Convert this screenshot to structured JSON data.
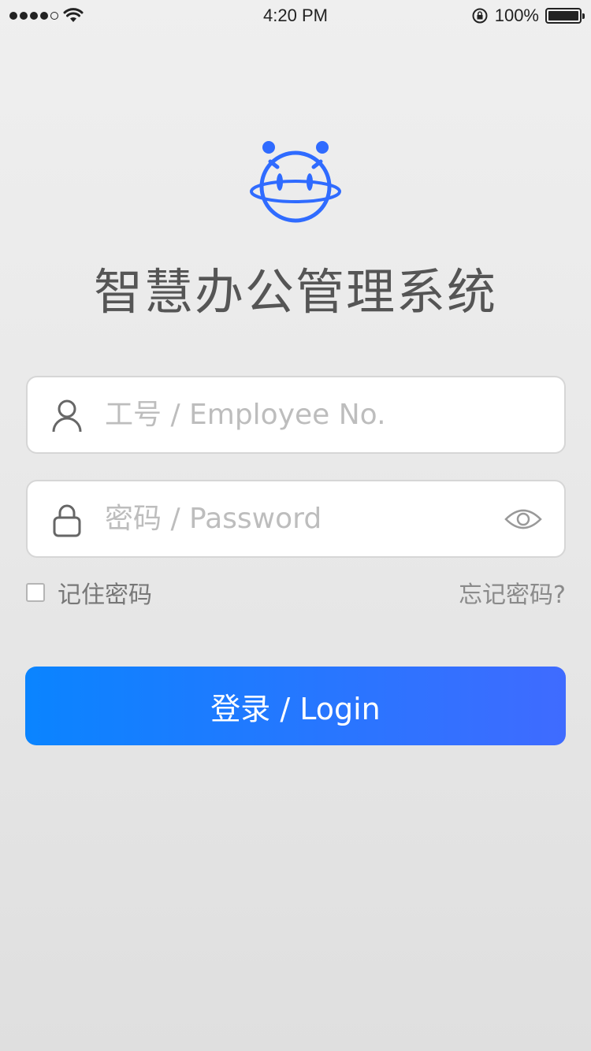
{
  "status_bar": {
    "time": "4:20 PM",
    "battery_percent": "100%",
    "signal_icon": "signal-dots-icon",
    "wifi_icon": "wifi-icon",
    "rotation_lock_icon": "rotation-lock-icon",
    "battery_icon": "battery-icon"
  },
  "app": {
    "logo_icon": "robot-planet-icon",
    "title": "智慧办公管理系统",
    "accent_color": "#2f6bff"
  },
  "form": {
    "employee_field": {
      "placeholder": "工号 / Employee No.",
      "value": "",
      "icon": "user-icon"
    },
    "password_field": {
      "placeholder": "密码 / Password",
      "value": "",
      "icon": "lock-icon",
      "toggle_icon": "eye-icon"
    },
    "remember_label": "记住密码",
    "remember_checked": false,
    "forgot_label": "忘记密码?",
    "login_label": "登录 / Login"
  }
}
